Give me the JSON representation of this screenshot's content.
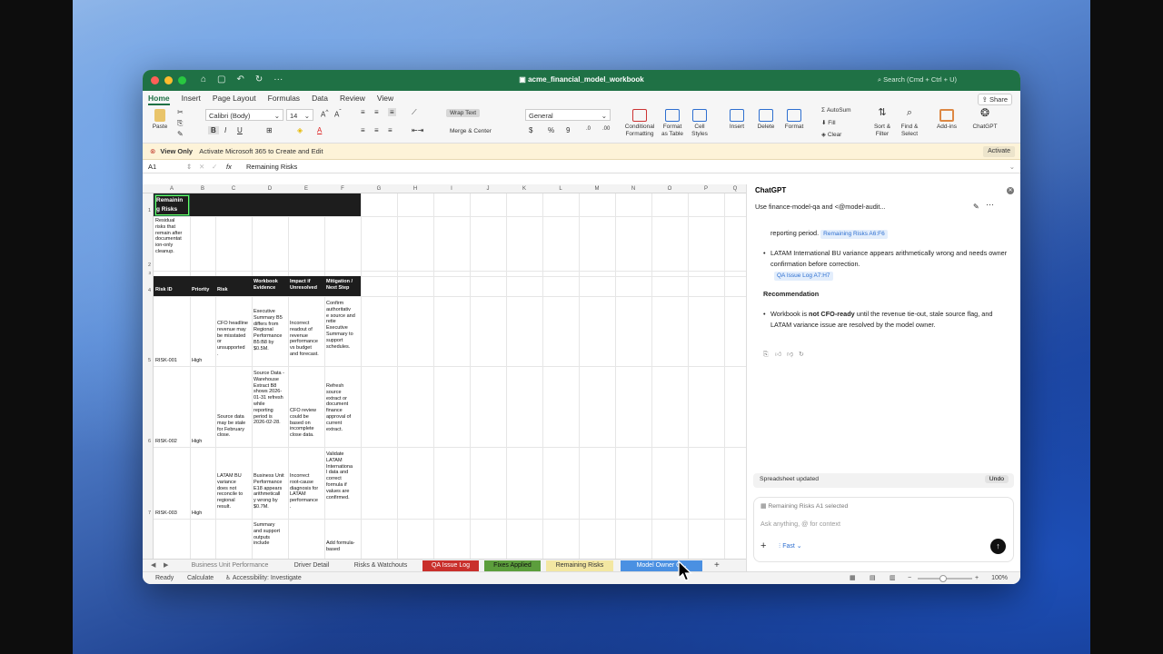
{
  "window": {
    "title": "acme_financial_model_workbook",
    "search": "Search (Cmd + Ctrl + U)",
    "share": "Share"
  },
  "ribbon_tabs": [
    "Home",
    "Insert",
    "Page Layout",
    "Formulas",
    "Data",
    "Review",
    "View"
  ],
  "ribbon": {
    "paste": "Paste",
    "font_name": "Calibri (Body)",
    "font_size": "14",
    "wrap_text": "Wrap Text",
    "merge_center": "Merge & Center",
    "number_format": "General",
    "conditional": "Conditional\nFormatting",
    "format_table": "Format\nas Table",
    "cell_styles": "Cell\nStyles",
    "insert": "Insert",
    "delete": "Delete",
    "format": "Format",
    "autosum": "AutoSum",
    "fill": "Fill",
    "clear": "Clear",
    "sort_filter": "Sort &\nFilter",
    "find_select": "Find &\nSelect",
    "addins": "Add-ins",
    "chatgpt": "ChatGPT"
  },
  "notice": {
    "title": "View Only",
    "text": "Activate Microsoft 365 to Create and Edit",
    "button": "Activate"
  },
  "formula_bar": {
    "ref": "A1",
    "fx": "fx",
    "value": "Remaining Risks"
  },
  "columns": [
    "A",
    "B",
    "C",
    "D",
    "E",
    "F",
    "G",
    "H",
    "I",
    "J",
    "K",
    "L",
    "M",
    "N",
    "O",
    "P",
    "Q"
  ],
  "rows": [
    "1",
    "2",
    "3",
    "4",
    "5",
    "6",
    "7"
  ],
  "sheet": {
    "title": "Remainin\ng Risks",
    "subtitle": "Residual\nrisks that\nremain after\ndocumentat\nion-only\ncleanup.",
    "headers": [
      "Risk ID",
      "Priority",
      "Risk",
      "Workbook\nEvidence",
      "Impact if\nUnresolved",
      "Mitigation /\nNext Step"
    ],
    "risks": [
      {
        "id": "RISK-001",
        "priority": "High",
        "risk": "CFO headline\nrevenue may\nbe misstated\nor\nunsupported\n.",
        "evidence": "Executive\nSummary B5\ndiffers from\nRegional\nPerformance\nB5:B8 by\n$0.5M.",
        "impact": "Incorrect\nreadout of\nrevenue\nperformance\nvs budget\nand forecast.",
        "mitigation": "Confirm\nauthoritativ\ne source and\nretie\nExecutive\nSummary to\nsupport\nschedules."
      },
      {
        "id": "RISK-002",
        "priority": "High",
        "risk": "Source data\nmay be stale\nfor February\nclose.",
        "evidence": "Source Data -\nWarehouse\nExtract B8\nshows 2026-\n01-31 refresh\nwhile\nreporting\nperiod is\n2026-02-28.",
        "impact": "CFO review\ncould be\nbased on\nincomplete\nclose data.",
        "mitigation": "Refresh\nsource\nextract or\ndocument\nfinance\napproval of\ncurrent\nextract."
      },
      {
        "id": "RISK-003",
        "priority": "High",
        "risk": "LATAM BU\nvariance\ndoes not\nreconcile to\nregional\nresult.",
        "evidence": "Business Unit\nPerformance\nE18 appears\narithmeticall\ny wrong by\n$0.7M.",
        "impact": "Incorrect\nroot-cause\ndiagnosis for\nLATAM\nperformance\n.",
        "mitigation": "Validate\nLATAM\nInternationa\nl data and\ncorrect\nformula if\nvalues are\nconfirmed."
      },
      {
        "evidence": "Summary\nand support\noutputs\ninclude",
        "mitigation": "Add formula-\nbased"
      }
    ]
  },
  "sheet_tabs": [
    "Business Unit Performance",
    "Driver Detail",
    "Risks & Watchouts",
    "QA Issue Log",
    "Fixes Applied",
    "Remaining Risks",
    "Model Owner Q..."
  ],
  "status": {
    "ready": "Ready",
    "calculate": "Calculate",
    "accessibility": "Accessibility: Investigate",
    "zoom": "100%"
  },
  "chat": {
    "title": "ChatGPT",
    "prompt": "Use finance-model-qa and <@model-audit...",
    "bullet0_tail": "reporting period.",
    "chip0": "Remaining Risks A6:F6",
    "bullet1": "LATAM International BU variance appears arithmetically wrong and needs owner confirmation before correction.",
    "chip1": "QA Issue Log A7:H7",
    "recommendation_title": "Recommendation",
    "rec_pre": "Workbook is ",
    "rec_bold": "not CFO-ready",
    "rec_post": " until the revenue tie-out, stale source flag, and LATAM variance issue are resolved by the model owner.",
    "updated": "Spreadsheet updated",
    "undo": "Undo",
    "selection": "Remaining Risks A1 selected",
    "placeholder": "Ask anything, @ for context",
    "mode": "Fast"
  },
  "colors": {
    "excel_green": "#1f7145",
    "qa_tab": "#c9302c",
    "fixes_tab": "#5c9e3c",
    "remaining_tab": "#f3e7a2",
    "owner_tab": "#4a90e2"
  }
}
